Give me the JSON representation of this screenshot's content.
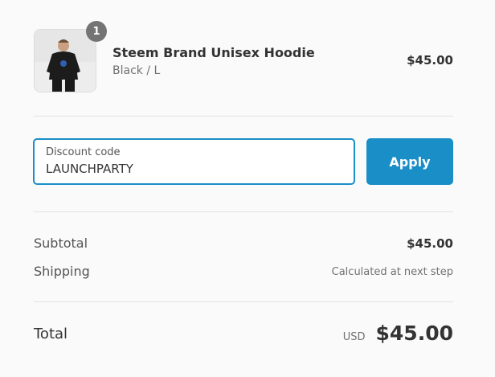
{
  "product": {
    "quantity": "1",
    "name": "Steem Brand Unisex Hoodie",
    "variant": "Black / L",
    "price": "$45.00",
    "image_icon": "hoodie-photo-icon"
  },
  "discount": {
    "label": "Discount code",
    "value": "LAUNCHPARTY",
    "apply_label": "Apply",
    "accent_color": "#1a8ec7"
  },
  "summary": {
    "subtotal_label": "Subtotal",
    "subtotal_value": "$45.00",
    "shipping_label": "Shipping",
    "shipping_value": "Calculated at next step",
    "total_label": "Total",
    "currency": "USD",
    "total_value": "$45.00"
  }
}
